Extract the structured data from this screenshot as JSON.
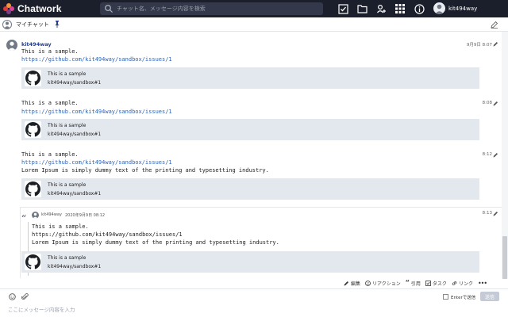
{
  "app": {
    "name": "Chatwork",
    "brand_colors": {
      "red": "#e1383d",
      "orange": "#f3963a",
      "pink": "#d9449a",
      "purple": "#7d3c8a"
    }
  },
  "topbar": {
    "search_placeholder": "チャット名、メッセージ内容を検索",
    "icons": [
      "task-icon",
      "file-icon",
      "contacts-icon",
      "apps-icon",
      "info-icon"
    ],
    "user_name": "kit494way"
  },
  "room": {
    "title": "マイチャット"
  },
  "messages": [
    {
      "sender": "kit494way",
      "time": "9月9日 8:07",
      "lines": [
        "This is a sample."
      ],
      "link": "https://github.com/kit494way/sandbox/issues/1",
      "preview": {
        "title": "This is a sample",
        "subtitle": "kit494way/sandbox#1"
      }
    },
    {
      "time": "8:08",
      "lines": [
        "This is a sample."
      ],
      "link": "https://github.com/kit494way/sandbox/issues/1",
      "preview": {
        "title": "This is a sample",
        "subtitle": "kit494way/sandbox#1"
      }
    },
    {
      "time": "8:12",
      "lines": [
        "This is a sample."
      ],
      "link": "https://github.com/kit494way/sandbox/issues/1",
      "extra_line": "Lorem Ipsum is simply dummy text of the printing and typesetting industry.",
      "preview": {
        "title": "This is a sample",
        "subtitle": "kit494way/sandbox#1"
      }
    }
  ],
  "quoted": {
    "time": "8:13",
    "sender": "kit494way",
    "date": "2020年9月9日 08:12",
    "lines": [
      "This is a sample.",
      "https://github.com/kit494way/sandbox/issues/1",
      "Lorem Ipsum is simply dummy text of the printing and typesetting industry."
    ],
    "preview": {
      "title": "This is a sample",
      "subtitle": "kit494way/sandbox#1"
    }
  },
  "action_bar": {
    "edit": "編集",
    "reaction": "リアクション",
    "quote": "引用",
    "task": "タスク",
    "link": "リンク",
    "more": "•••"
  },
  "composer": {
    "placeholder": "ここにメッセージ内容を入力",
    "enter_label": "Enterで送信",
    "send_label": "送信"
  }
}
